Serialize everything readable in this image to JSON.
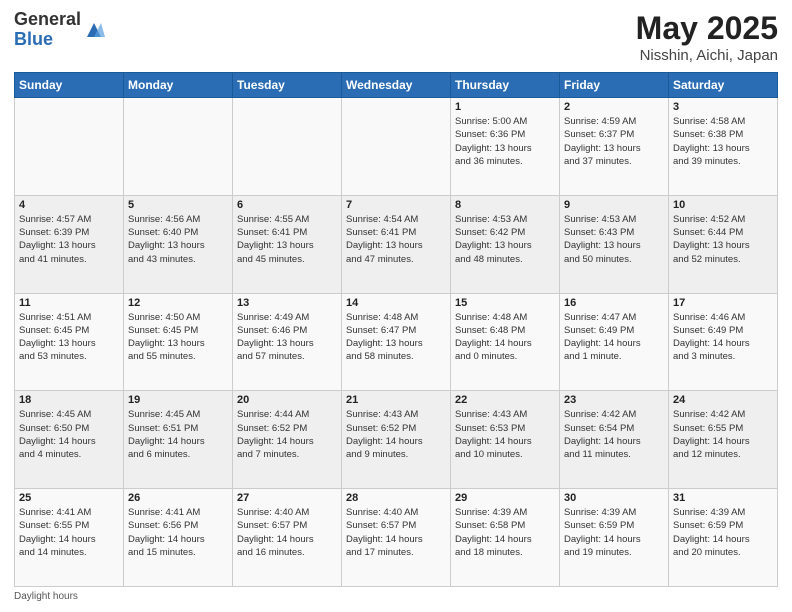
{
  "header": {
    "logo_general": "General",
    "logo_blue": "Blue",
    "title": "May 2025",
    "subtitle": "Nisshin, Aichi, Japan"
  },
  "weekdays": [
    "Sunday",
    "Monday",
    "Tuesday",
    "Wednesday",
    "Thursday",
    "Friday",
    "Saturday"
  ],
  "weeks": [
    [
      {
        "day": "",
        "info": ""
      },
      {
        "day": "",
        "info": ""
      },
      {
        "day": "",
        "info": ""
      },
      {
        "day": "",
        "info": ""
      },
      {
        "day": "1",
        "info": "Sunrise: 5:00 AM\nSunset: 6:36 PM\nDaylight: 13 hours\nand 36 minutes."
      },
      {
        "day": "2",
        "info": "Sunrise: 4:59 AM\nSunset: 6:37 PM\nDaylight: 13 hours\nand 37 minutes."
      },
      {
        "day": "3",
        "info": "Sunrise: 4:58 AM\nSunset: 6:38 PM\nDaylight: 13 hours\nand 39 minutes."
      }
    ],
    [
      {
        "day": "4",
        "info": "Sunrise: 4:57 AM\nSunset: 6:39 PM\nDaylight: 13 hours\nand 41 minutes."
      },
      {
        "day": "5",
        "info": "Sunrise: 4:56 AM\nSunset: 6:40 PM\nDaylight: 13 hours\nand 43 minutes."
      },
      {
        "day": "6",
        "info": "Sunrise: 4:55 AM\nSunset: 6:41 PM\nDaylight: 13 hours\nand 45 minutes."
      },
      {
        "day": "7",
        "info": "Sunrise: 4:54 AM\nSunset: 6:41 PM\nDaylight: 13 hours\nand 47 minutes."
      },
      {
        "day": "8",
        "info": "Sunrise: 4:53 AM\nSunset: 6:42 PM\nDaylight: 13 hours\nand 48 minutes."
      },
      {
        "day": "9",
        "info": "Sunrise: 4:53 AM\nSunset: 6:43 PM\nDaylight: 13 hours\nand 50 minutes."
      },
      {
        "day": "10",
        "info": "Sunrise: 4:52 AM\nSunset: 6:44 PM\nDaylight: 13 hours\nand 52 minutes."
      }
    ],
    [
      {
        "day": "11",
        "info": "Sunrise: 4:51 AM\nSunset: 6:45 PM\nDaylight: 13 hours\nand 53 minutes."
      },
      {
        "day": "12",
        "info": "Sunrise: 4:50 AM\nSunset: 6:45 PM\nDaylight: 13 hours\nand 55 minutes."
      },
      {
        "day": "13",
        "info": "Sunrise: 4:49 AM\nSunset: 6:46 PM\nDaylight: 13 hours\nand 57 minutes."
      },
      {
        "day": "14",
        "info": "Sunrise: 4:48 AM\nSunset: 6:47 PM\nDaylight: 13 hours\nand 58 minutes."
      },
      {
        "day": "15",
        "info": "Sunrise: 4:48 AM\nSunset: 6:48 PM\nDaylight: 14 hours\nand 0 minutes."
      },
      {
        "day": "16",
        "info": "Sunrise: 4:47 AM\nSunset: 6:49 PM\nDaylight: 14 hours\nand 1 minute."
      },
      {
        "day": "17",
        "info": "Sunrise: 4:46 AM\nSunset: 6:49 PM\nDaylight: 14 hours\nand 3 minutes."
      }
    ],
    [
      {
        "day": "18",
        "info": "Sunrise: 4:45 AM\nSunset: 6:50 PM\nDaylight: 14 hours\nand 4 minutes."
      },
      {
        "day": "19",
        "info": "Sunrise: 4:45 AM\nSunset: 6:51 PM\nDaylight: 14 hours\nand 6 minutes."
      },
      {
        "day": "20",
        "info": "Sunrise: 4:44 AM\nSunset: 6:52 PM\nDaylight: 14 hours\nand 7 minutes."
      },
      {
        "day": "21",
        "info": "Sunrise: 4:43 AM\nSunset: 6:52 PM\nDaylight: 14 hours\nand 9 minutes."
      },
      {
        "day": "22",
        "info": "Sunrise: 4:43 AM\nSunset: 6:53 PM\nDaylight: 14 hours\nand 10 minutes."
      },
      {
        "day": "23",
        "info": "Sunrise: 4:42 AM\nSunset: 6:54 PM\nDaylight: 14 hours\nand 11 minutes."
      },
      {
        "day": "24",
        "info": "Sunrise: 4:42 AM\nSunset: 6:55 PM\nDaylight: 14 hours\nand 12 minutes."
      }
    ],
    [
      {
        "day": "25",
        "info": "Sunrise: 4:41 AM\nSunset: 6:55 PM\nDaylight: 14 hours\nand 14 minutes."
      },
      {
        "day": "26",
        "info": "Sunrise: 4:41 AM\nSunset: 6:56 PM\nDaylight: 14 hours\nand 15 minutes."
      },
      {
        "day": "27",
        "info": "Sunrise: 4:40 AM\nSunset: 6:57 PM\nDaylight: 14 hours\nand 16 minutes."
      },
      {
        "day": "28",
        "info": "Sunrise: 4:40 AM\nSunset: 6:57 PM\nDaylight: 14 hours\nand 17 minutes."
      },
      {
        "day": "29",
        "info": "Sunrise: 4:39 AM\nSunset: 6:58 PM\nDaylight: 14 hours\nand 18 minutes."
      },
      {
        "day": "30",
        "info": "Sunrise: 4:39 AM\nSunset: 6:59 PM\nDaylight: 14 hours\nand 19 minutes."
      },
      {
        "day": "31",
        "info": "Sunrise: 4:39 AM\nSunset: 6:59 PM\nDaylight: 14 hours\nand 20 minutes."
      }
    ]
  ],
  "footer": {
    "daylight_label": "Daylight hours"
  }
}
